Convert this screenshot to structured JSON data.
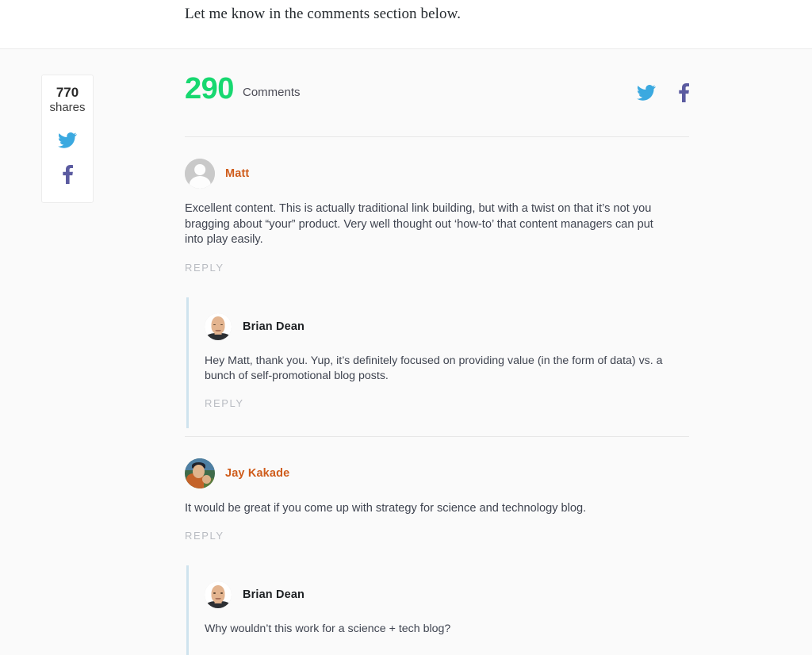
{
  "article": {
    "closing_line": "Let me know in the comments section below."
  },
  "share_rail": {
    "count": "770",
    "label": "shares",
    "twitter_icon": "twitter-icon",
    "facebook_icon": "facebook-icon"
  },
  "comments_header": {
    "count": "290",
    "word": "Comments",
    "twitter_icon": "twitter-icon",
    "facebook_icon": "facebook-icon"
  },
  "colors": {
    "count_green": "#17d870",
    "commenter_orange": "#cf5c1b",
    "twitter_blue": "#3ba9e0",
    "facebook_purple": "#5b5ba0",
    "nested_border": "#cfe3ee",
    "page_background": "#fafafa"
  },
  "reply_label": "REPLY",
  "threads": [
    {
      "author": "Matt",
      "avatar": "default-avatar",
      "is_author": false,
      "text": "Excellent content. This is actually traditional link building, but with a twist on that it’s not you bragging about “your” product. Very well thought out ‘how-to’ that content managers can put into play easily.",
      "reply": {
        "author": "Brian Dean",
        "avatar": "brian-dean-avatar",
        "is_author": true,
        "text": "Hey Matt, thank you. Yup, it’s definitely focused on providing value (in the form of data) vs. a bunch of self-promotional blog posts."
      }
    },
    {
      "author": "Jay Kakade",
      "avatar": "jay-kakade-avatar",
      "is_author": false,
      "text": "It would be great if you come up with strategy for science and technology blog.",
      "reply": {
        "author": "Brian Dean",
        "avatar": "brian-dean-avatar",
        "is_author": true,
        "text": "Why wouldn’t this work for a science + tech blog?"
      }
    }
  ]
}
